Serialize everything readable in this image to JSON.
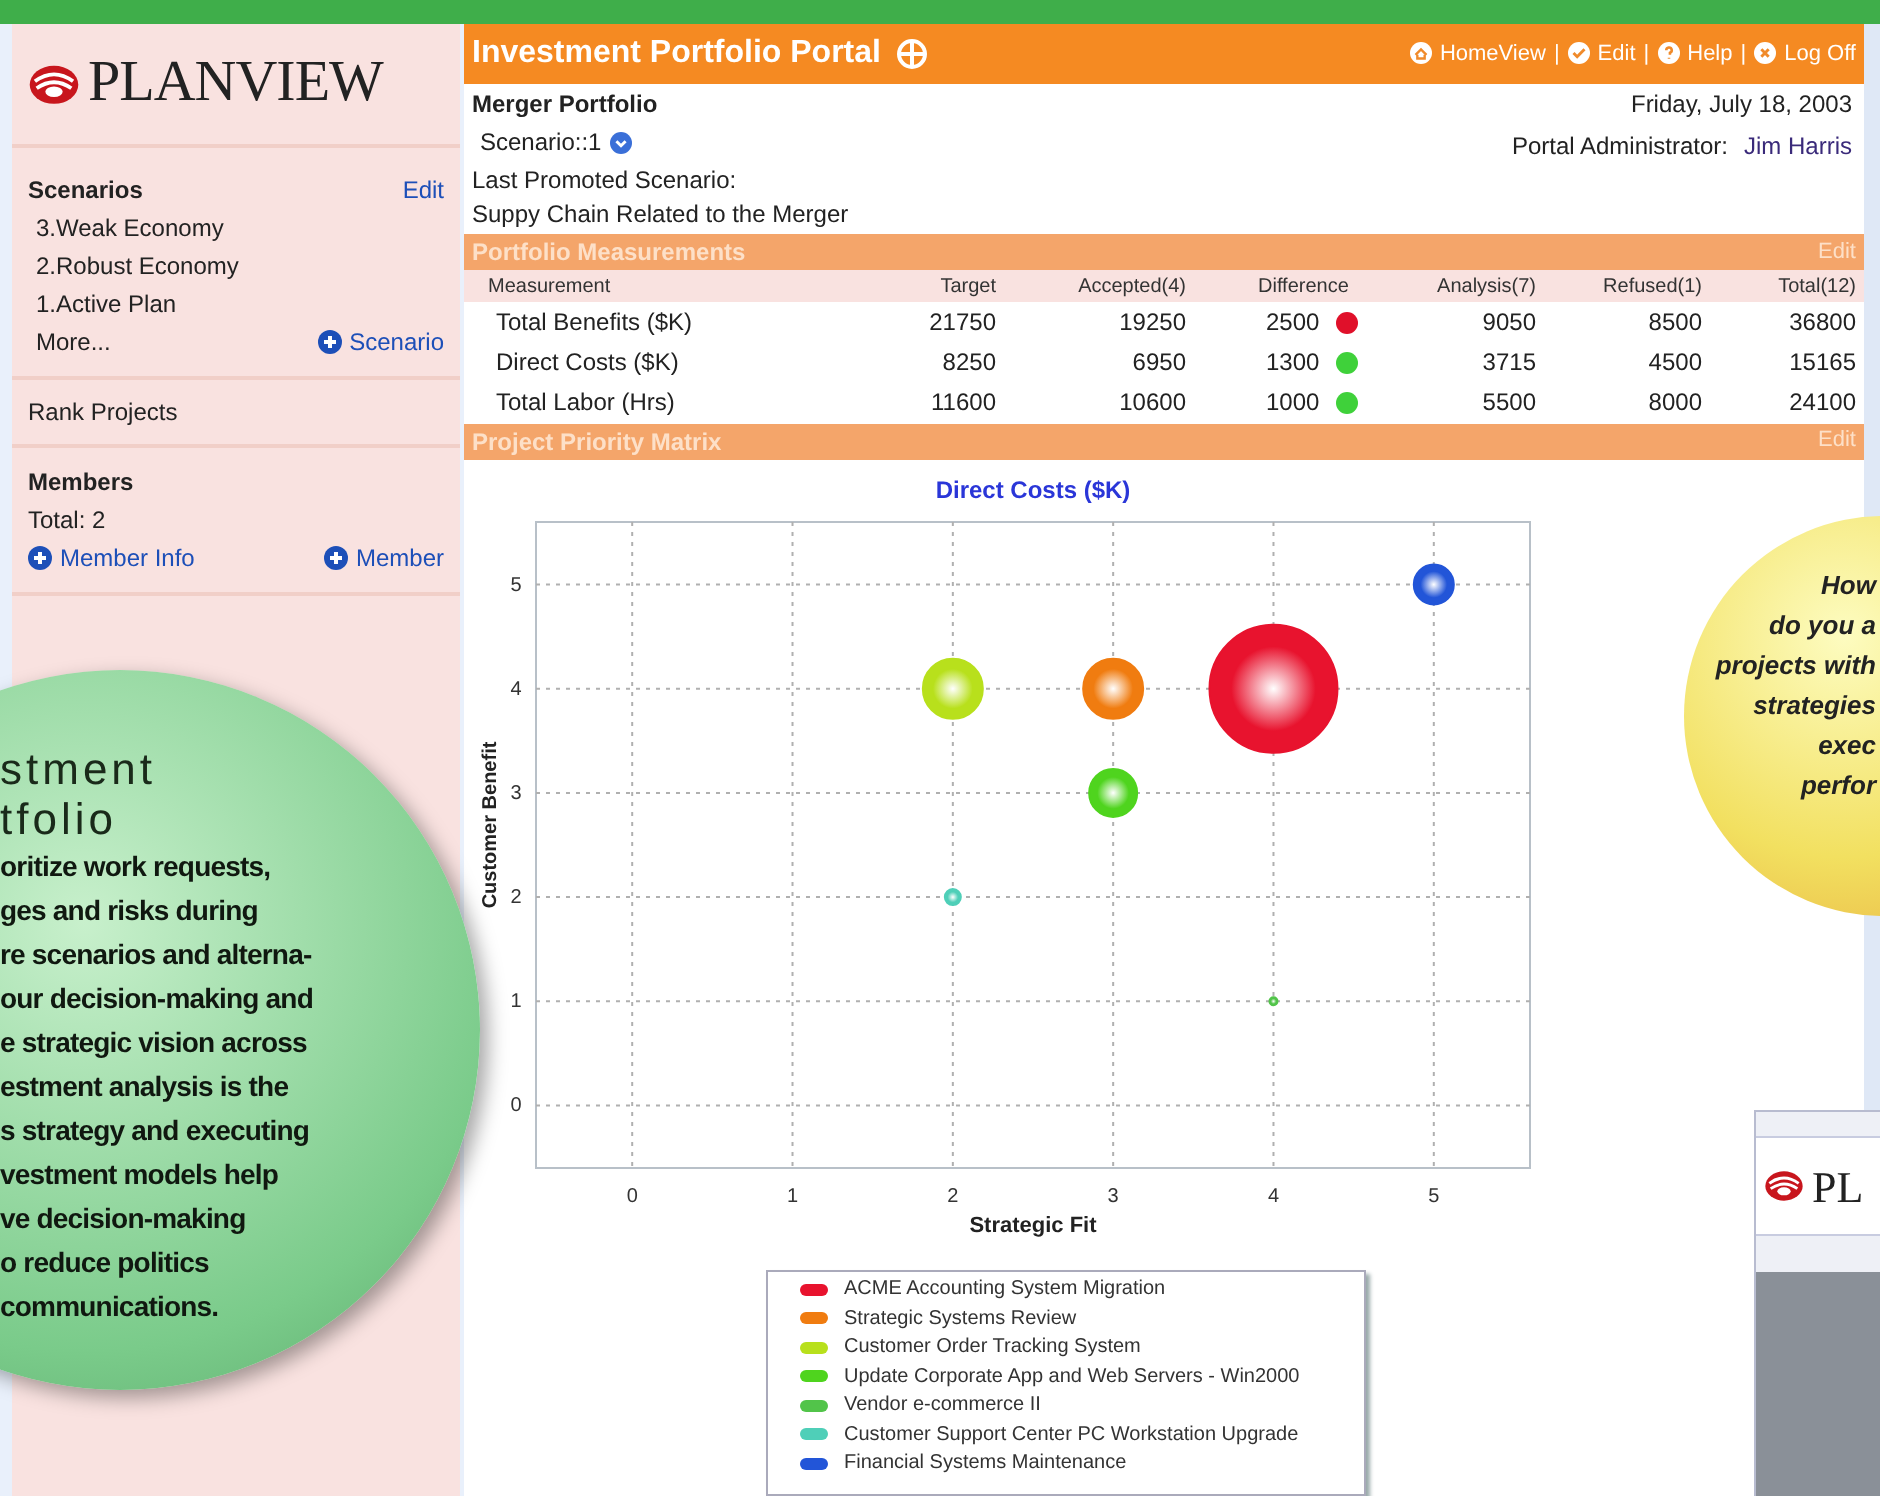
{
  "sidebar": {
    "logo": "PLANVIEW",
    "scenarios": {
      "heading": "Scenarios",
      "edit": "Edit",
      "items": [
        "3.Weak Economy",
        "2.Robust Economy",
        "1.Active Plan"
      ],
      "more": "More...",
      "add": "Scenario"
    },
    "rank_projects": "Rank Projects",
    "members": {
      "heading": "Members",
      "total": "Total: 2",
      "info_link": "Member Info",
      "add": "Member"
    }
  },
  "header": {
    "title": "Investment Portfolio Portal",
    "nav": [
      "HomeView",
      "Edit",
      "Help",
      "Log Off"
    ],
    "separator": "|"
  },
  "info": {
    "portfolio": "Merger Portfolio",
    "scenario": "Scenario::1",
    "date": "Friday, July 18, 2003",
    "admin_label": "Portal Administrator:",
    "admin_name": "Jim Harris",
    "promoted_label": "Last Promoted Scenario:",
    "promoted_value": "Suppy Chain Related to the Merger"
  },
  "measurements": {
    "title": "Portfolio Measurements",
    "edit": "Edit",
    "columns": [
      "Measurement",
      "Target",
      "Accepted(4)",
      "Difference",
      "Analysis(7)",
      "Refused(1)",
      "Total(12)"
    ],
    "rows": [
      {
        "measurement": "Total Benefits ($K)",
        "target": "21750",
        "accepted": "19250",
        "difference": "2500",
        "color": "#e0102a",
        "analysis": "9050",
        "refused": "8500",
        "total": "36800"
      },
      {
        "measurement": "Direct Costs ($K)",
        "target": "8250",
        "accepted": "6950",
        "difference": "1300",
        "color": "#3fd13a",
        "analysis": "3715",
        "refused": "4500",
        "total": "15165"
      },
      {
        "measurement": "Total Labor (Hrs)",
        "target": "11600",
        "accepted": "10600",
        "difference": "1000",
        "color": "#3fd13a",
        "analysis": "5500",
        "refused": "8000",
        "total": "24100"
      }
    ]
  },
  "matrix": {
    "title": "Project Priority Matrix",
    "edit": "Edit",
    "bubbles": [
      {
        "kind": "huge"
      },
      {
        "kind": "large"
      },
      {
        "kind": "large"
      },
      {
        "kind": "medium"
      },
      {
        "kind": "dot"
      },
      {
        "kind": "tiny"
      },
      {
        "kind": "small"
      }
    ],
    "chart_data": {
      "type": "scatter",
      "title": "Direct Costs ($K)",
      "xlabel": "Strategic Fit",
      "ylabel": "Customer Benefit",
      "x": [
        2,
        3,
        4,
        5
      ],
      "xlim": [
        -0.6,
        5.6
      ],
      "ylim": [
        -0.6,
        5.6
      ],
      "xticks": [
        0,
        1,
        2,
        3,
        4,
        5
      ],
      "yticks": [
        0,
        1,
        2,
        3,
        4,
        5
      ],
      "grid": true,
      "series": [
        {
          "name": "ACME Accounting System Migration",
          "color": "#e8132e",
          "values": [
            null,
            null,
            4,
            null
          ]
        },
        {
          "name": "Strategic Systems Review",
          "color": "#f07c10",
          "values": [
            null,
            4,
            null,
            null
          ]
        },
        {
          "name": "Customer Order Tracking System",
          "color": "#b8e01c",
          "values": [
            4,
            null,
            null,
            null
          ]
        },
        {
          "name": "Update Corporate App and Web Servers - Win2000",
          "color": "#4fd41e",
          "values": [
            null,
            3,
            null,
            null
          ]
        },
        {
          "name": "Vendor e-commerce II",
          "color": "#52c44a",
          "values": [
            null,
            null,
            1,
            null
          ]
        },
        {
          "name": "Customer Support Center PC Workstation Upgrade",
          "color": "#4fcfb8",
          "values": [
            2,
            null,
            null,
            null
          ]
        },
        {
          "name": "Financial Systems Maintenance",
          "color": "#2255d8",
          "values": [
            null,
            null,
            null,
            5
          ]
        }
      ]
    }
  },
  "promo_left": {
    "heading_lines": [
      "stment",
      "tfolio"
    ],
    "lines": [
      "oritize work requests,",
      "ges and risks during",
      "re scenarios and alterna-",
      "our decision-making and",
      "e strategic vision across",
      "estment analysis is the",
      "s strategy and executing",
      "vestment models help",
      "ve decision-making",
      "o reduce politics",
      "communications."
    ]
  },
  "promo_right": {
    "lines": [
      "How",
      "do you a",
      "projects with",
      "strategies",
      "exec",
      "perfor"
    ]
  },
  "brochure": {
    "logo": "PL"
  }
}
